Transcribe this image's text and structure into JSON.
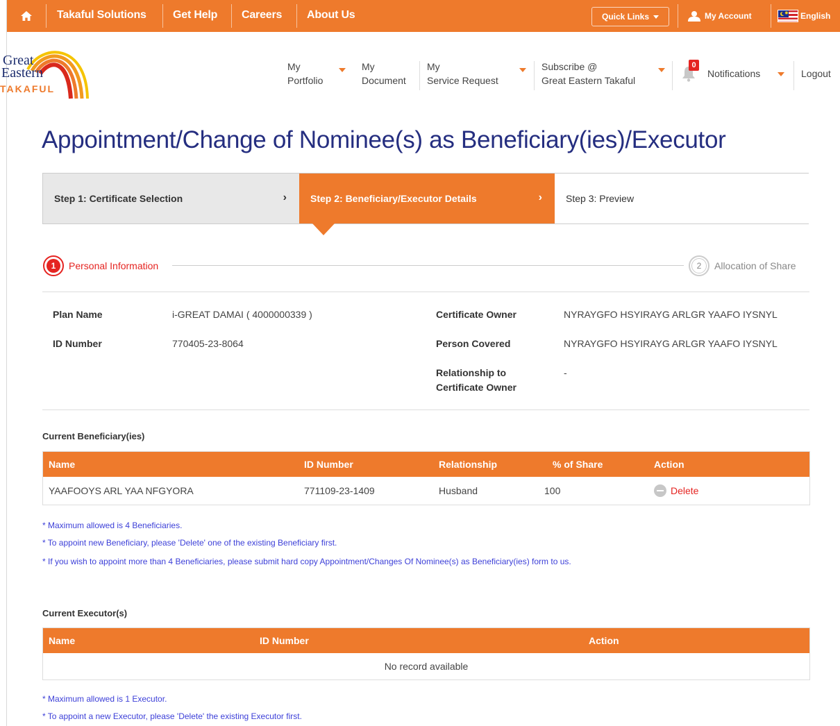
{
  "topbar": {
    "nav": [
      "Takaful Solutions",
      "Get Help",
      "Careers",
      "About Us"
    ],
    "quick_links": "Quick Links",
    "account": "My Account",
    "language": "English"
  },
  "logo": {
    "line1": "Great",
    "line2": "Eastern",
    "line3": "TAKAFUL"
  },
  "menu": {
    "portfolio": [
      "My",
      "Portfolio"
    ],
    "document": [
      "My",
      "Document"
    ],
    "service": [
      "My",
      "Service Request"
    ],
    "subscribe": [
      "Subscribe @",
      "Great Eastern Takaful"
    ],
    "notifications": "Notifications",
    "notification_count": "0",
    "logout": "Logout"
  },
  "page_title": "Appointment/Change of Nominee(s) as Beneficiary(ies)/Executor",
  "steps": [
    {
      "label": "Step 1: Certificate Selection"
    },
    {
      "label": "Step 2: Beneficiary/Executor Details"
    },
    {
      "label": "Step 3: Preview"
    }
  ],
  "substeps": [
    {
      "num": "1",
      "label": "Personal Information"
    },
    {
      "num": "2",
      "label": "Allocation of Share"
    }
  ],
  "info": {
    "plan_name_label": "Plan Name",
    "plan_name": "i-GREAT DAMAI ( 4000000339 )",
    "id_number_label": "ID Number",
    "id_number": "770405-23-8064",
    "owner_label": "Certificate Owner",
    "owner": "NYRAYGFO HSYIRAYG ARLGR YAAFO IYSNYL",
    "covered_label": "Person Covered",
    "covered": "NYRAYGFO HSYIRAYG ARLGR YAAFO IYSNYL",
    "relationship_label_1": "Relationship to",
    "relationship_label_2": "Certificate Owner",
    "relationship": "-"
  },
  "beneficiaries": {
    "title": "Current Beneficiary(ies)",
    "headers": [
      "Name",
      "ID Number",
      "Relationship",
      "% of Share",
      "Action"
    ],
    "rows": [
      {
        "name": "YAAFOOYS ARL YAA NFGYORA",
        "id": "771109-23-1409",
        "relationship": "Husband",
        "share": "100",
        "action": "Delete"
      }
    ],
    "notes": [
      "* Maximum allowed is 4 Beneficiaries.",
      "* To appoint new Beneficiary, please 'Delete' one of the existing Beneficiary first.",
      "* If you wish to appoint more than 4 Beneficiaries, please submit hard copy Appointment/Changes Of Nominee(s) as Beneficiary(ies) form to us."
    ]
  },
  "executors": {
    "title": "Current Executor(s)",
    "headers": [
      "Name",
      "ID Number",
      "Action"
    ],
    "empty": "No record available",
    "notes": [
      "* Maximum allowed is 1 Executor.",
      "* To appoint a new Executor, please 'Delete' the existing Executor first."
    ]
  },
  "colors": {
    "brand_orange": "#ee7a2c",
    "title_blue": "#252e80",
    "alert_red": "#e52421",
    "note_blue": "#3c3fd8"
  }
}
